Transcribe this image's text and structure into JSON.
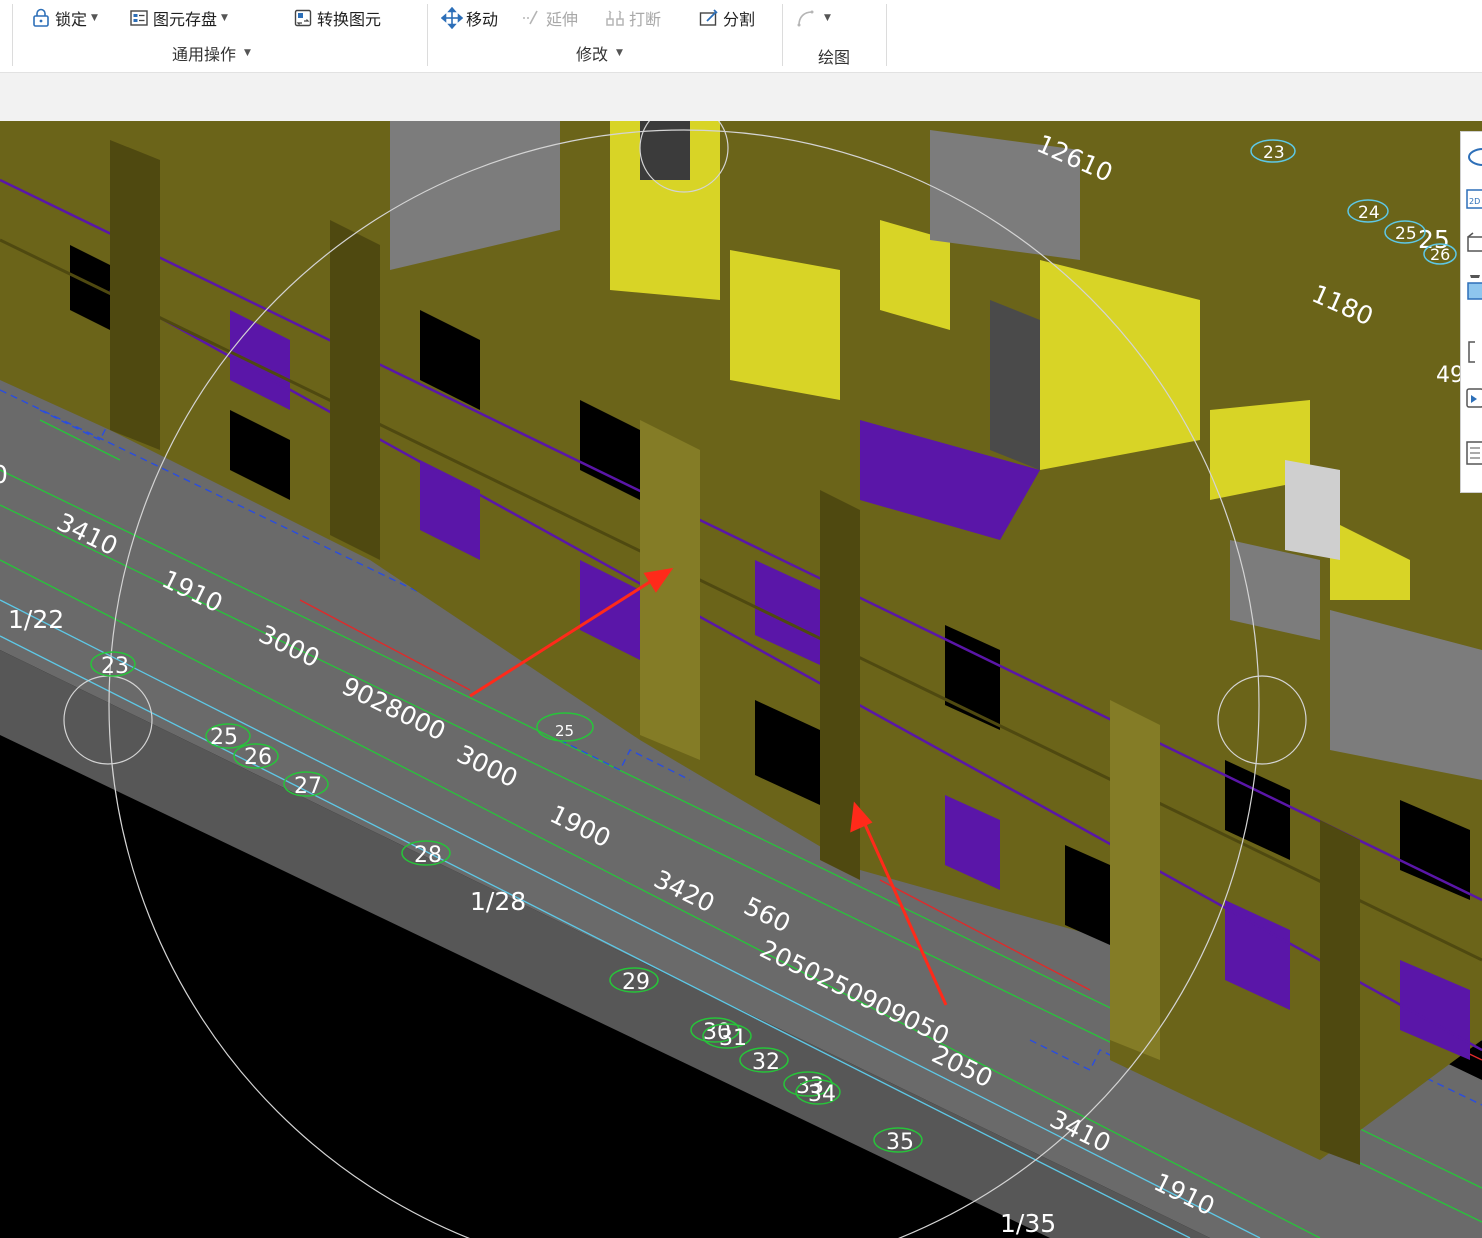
{
  "toolbar": {
    "lock_label": "锁定",
    "save_element_label": "图元存盘",
    "convert_label": "转换图元",
    "move_label": "移动",
    "extend_label": "延伸",
    "break_label": "打断",
    "split_label": "分割",
    "group_general": "通用操作",
    "group_modify": "修改",
    "group_draw": "绘图"
  },
  "viewport": {
    "dims": [
      "12610",
      "1180",
      "3410",
      "1910",
      "3000",
      "9028000",
      "3000",
      "1900",
      "3420",
      "560",
      "2050250909050",
      "2050",
      "3410",
      "1910"
    ],
    "axis_ids": [
      "23",
      "24",
      "25",
      "26",
      "27",
      "28",
      "29",
      "30",
      "31",
      "32",
      "33",
      "34",
      "35",
      "25",
      "26",
      "25",
      "23"
    ],
    "fraction_labels": [
      "1/22",
      "1/28",
      "1/35"
    ],
    "left_edge_label": "0",
    "right_edge_label": "25",
    "right_edge_label_2": "49"
  },
  "colors": {
    "wall_olive": "#6b6419",
    "wall_olive_dark": "#4f4910",
    "wall_olive_light": "#847c26",
    "slab_purple": "#5a16a8",
    "wall_yellow": "#d8d426",
    "wall_grey": "#7c7c7c",
    "floor_grey": "#6a6a6a",
    "dim_green": "#27c43a",
    "line_cyan": "#5ec8e6",
    "line_red": "#e02a2a",
    "line_blue": "#2a4ddf",
    "arrow_red": "#ff2a1a"
  },
  "right_tools": [
    "view-icon",
    "2d-icon",
    "box-icon",
    "box-blue-icon",
    "bracket-icon",
    "layer-icon",
    "list-icon"
  ]
}
